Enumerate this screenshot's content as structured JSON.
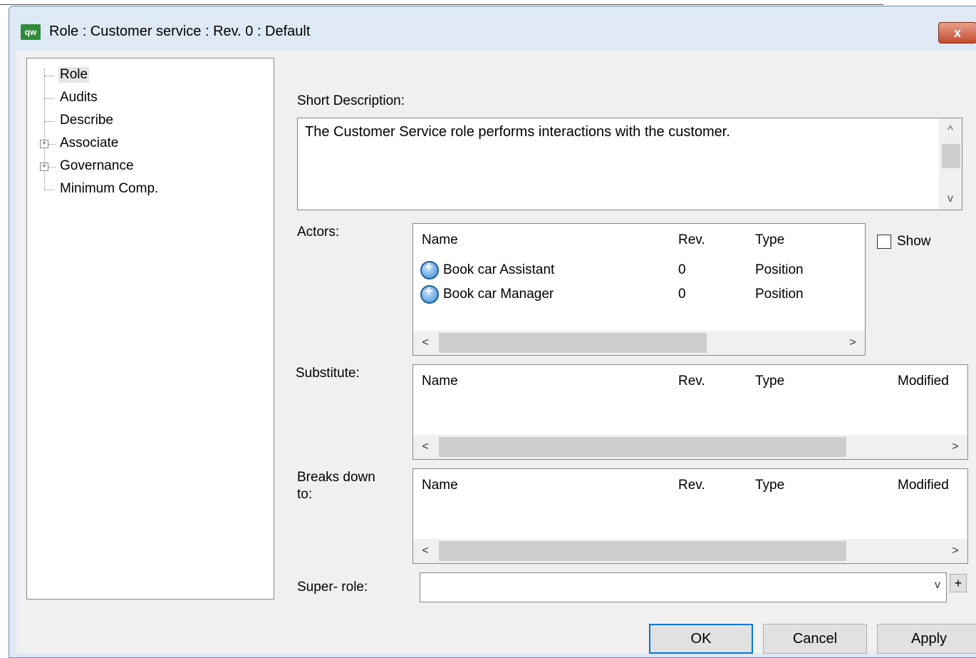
{
  "window": {
    "app_icon_text": "qw",
    "title": "Role : Customer service : Rev. 0  : Default",
    "close_symbol": "x"
  },
  "tree": {
    "items": [
      {
        "label": "Role",
        "selected": true,
        "expandable": false
      },
      {
        "label": "Audits",
        "selected": false,
        "expandable": false
      },
      {
        "label": "Describe",
        "selected": false,
        "expandable": false
      },
      {
        "label": "Associate",
        "selected": false,
        "expandable": true
      },
      {
        "label": "Governance",
        "selected": false,
        "expandable": true
      },
      {
        "label": "Minimum Comp.",
        "selected": false,
        "expandable": false
      }
    ],
    "expand_symbol": "+"
  },
  "short_description": {
    "label": "Short Description:",
    "value": "The Customer Service role performs interactions with the customer."
  },
  "actors": {
    "label": "Actors:",
    "columns": [
      "Name",
      "Rev.",
      "Type"
    ],
    "rows": [
      {
        "name": "Book car Assistant",
        "rev": "0",
        "type": "Position",
        "icon": "position-icon"
      },
      {
        "name": "Book car Manager",
        "rev": "0",
        "type": "Position",
        "icon": "position-icon"
      }
    ],
    "show_label": "Show"
  },
  "substitute": {
    "label": "Substitute:",
    "columns": [
      "Name",
      "Rev.",
      "Type",
      "Modified"
    ]
  },
  "breaks_down": {
    "label_line1": "Breaks down",
    "label_line2": "to:",
    "columns": [
      "Name",
      "Rev.",
      "Type",
      "Modified"
    ]
  },
  "super_role": {
    "label": "Super- role:",
    "value": "",
    "add_symbol": "+"
  },
  "scroll": {
    "left": "<",
    "right": ">",
    "up": "^",
    "down": "v"
  },
  "buttons": {
    "ok": "OK",
    "cancel": "Cancel",
    "apply": "Apply"
  },
  "colors": {
    "accent": "#0078d7",
    "app_icon": "#2e8b3a",
    "close": "#c44b2f"
  }
}
